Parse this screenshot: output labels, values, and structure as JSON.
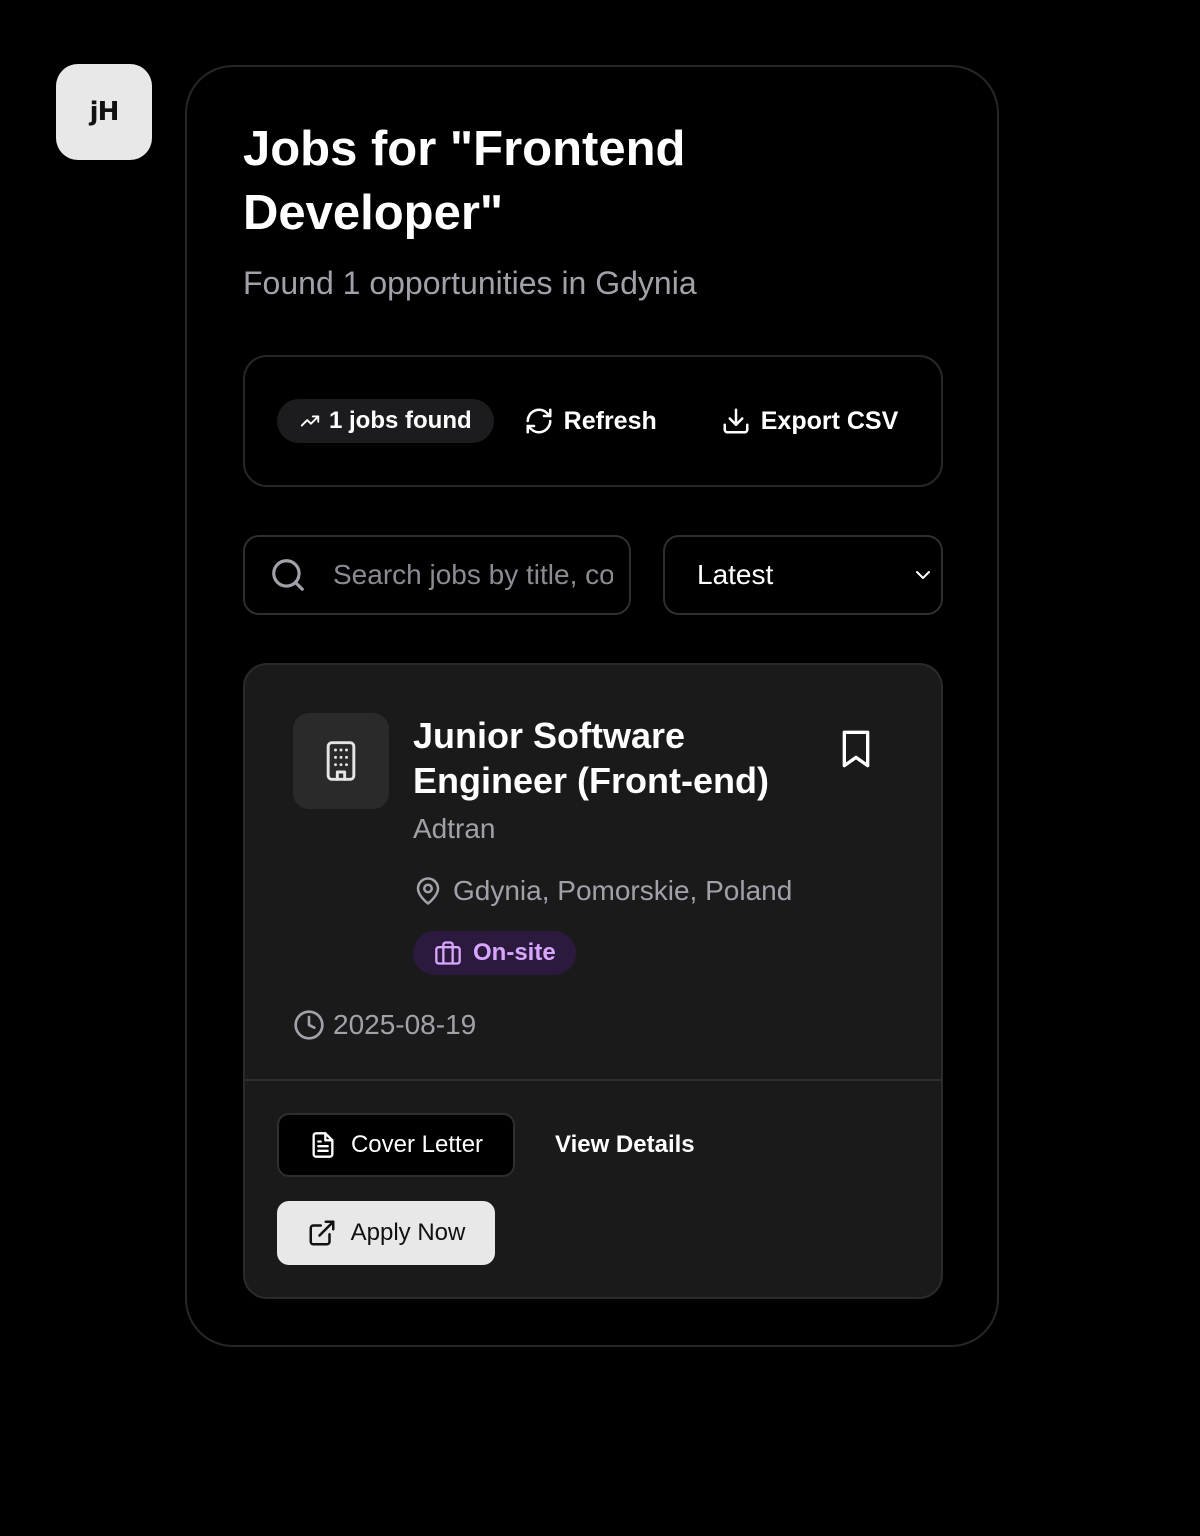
{
  "app": {
    "logo_text": "jH"
  },
  "header": {
    "title": "Jobs for \"Frontend Developer\"",
    "subtitle": "Found 1 opportunities in Gdynia"
  },
  "toolbar": {
    "jobs_found_label": "1 jobs found",
    "refresh_label": "Refresh",
    "export_label": "Export CSV"
  },
  "filters": {
    "search_placeholder": "Search jobs by title, company, or location",
    "search_value": "",
    "sort_selected": "Latest"
  },
  "jobs": [
    {
      "title": "Junior Software Engineer (Front-end)",
      "company": "Adtran",
      "location": "Gdynia, Pomorskie, Poland",
      "work_type": "On-site",
      "posted_date": "2025-08-19",
      "actions": {
        "cover_letter_label": "Cover Letter",
        "view_details_label": "View Details",
        "apply_label": "Apply Now"
      }
    }
  ],
  "colors": {
    "background": "#000000",
    "card": "#1a1a1a",
    "muted_text": "#a1a1aa",
    "worktype_badge_bg": "#2b1a3d",
    "worktype_badge_text": "#d8a6ff",
    "apply_button_bg": "#e8e8e8"
  }
}
